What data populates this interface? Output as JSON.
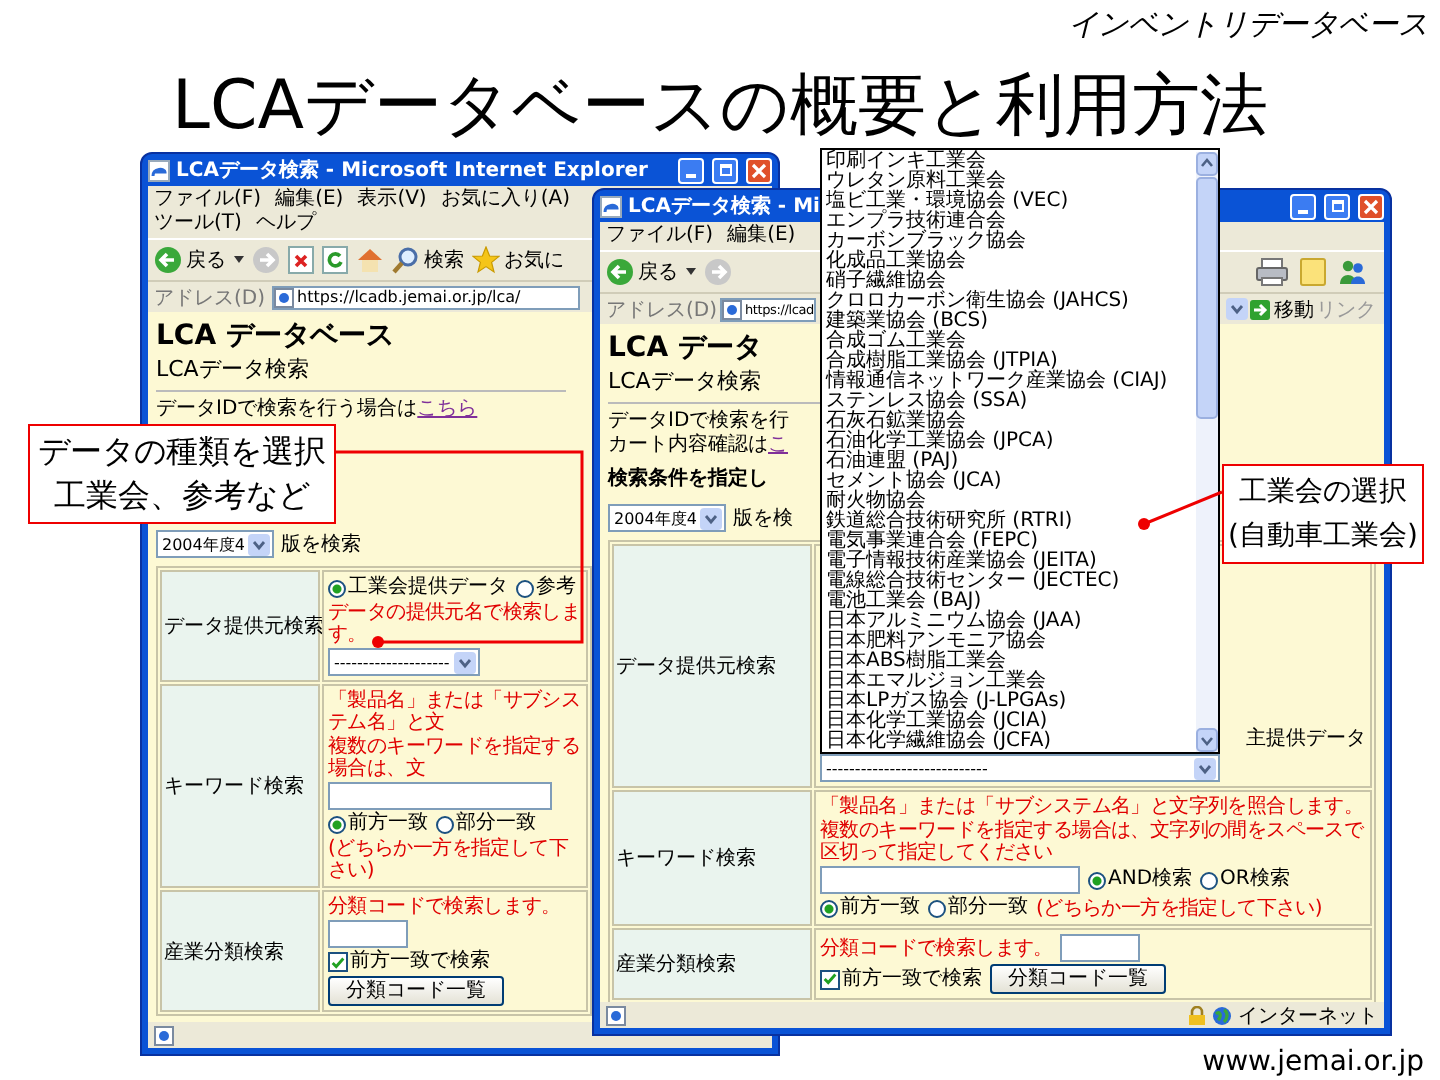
{
  "slide": {
    "subtitle": "インベントリデータベース",
    "title": "LCAデータベースの概要と利用方法",
    "footer": "www.jemai.or.jp"
  },
  "windows": [
    {
      "title": "LCAデータ検索 - Microsoft Internet Explorer",
      "menu": [
        "ファイル(F)",
        "編集(E)",
        "表示(V)",
        "お気に入り(A)",
        "ツール(T)",
        "ヘルプ"
      ],
      "toolbar": {
        "back": "戻る",
        "search": "検索",
        "favorites": "お気に"
      },
      "address": {
        "label": "アドレス(D)",
        "url": "https://lcadb.jemai.or.jp/lca/"
      },
      "page": {
        "heading": "LCA データベース",
        "subheading": "LCAデータ検索",
        "lines": [
          {
            "text": "データIDで検索を行う場合は",
            "link": "こちら"
          }
        ],
        "version": {
          "value": "2004年度4",
          "label": "版を検索"
        }
      },
      "form": [
        {
          "kind": "source",
          "label": "データ提供元検索",
          "options": [
            {
              "label": "工業会提供データ",
              "selected": true
            },
            {
              "label": "参考",
              "selected": false
            }
          ],
          "note": "データの提供元名で検索します。",
          "select": "--------------------"
        },
        {
          "kind": "keyword",
          "label": "キーワード検索",
          "notes": [
            "「製品名」または「サブシステム名」と文",
            "複数のキーワードを指定する場合は、文"
          ],
          "match": [
            {
              "label": "前方一致",
              "selected": true
            },
            {
              "label": "部分一致",
              "selected": false
            }
          ],
          "hint": "(どちらか一方を指定して下さい)"
        },
        {
          "kind": "category",
          "label": "産業分類検索",
          "note": "分類コードで検索します。",
          "checkbox": {
            "label": "前方一致で検索",
            "checked": true
          },
          "button": "分類コード一覧"
        }
      ]
    },
    {
      "title": "LCAデータ検索 - Mi",
      "menu": [
        "ファイル(F)",
        "編集(E)"
      ],
      "toolbar": {
        "back": "戻る"
      },
      "address": {
        "label": "アドレス(D)",
        "url": "https://lcad",
        "go": "移動",
        "links": "リンク"
      },
      "page": {
        "heading": "LCA データ",
        "subheading": "LCAデータ検索",
        "lines": [
          {
            "text": "データIDで検索を行"
          },
          {
            "text": "カート内容確認は",
            "link": "こ"
          }
        ],
        "bold_line": "検索条件を指定し",
        "version": {
          "value": "2004年度4",
          "label": "版を検"
        }
      },
      "form": [
        {
          "kind": "source",
          "label": "データ提供元検索",
          "tail": "主提供データ",
          "select": "----------------------------",
          "list": [
            "印刷インキ工業会",
            "ウレタン原料工業会",
            "塩ビ工業・環境協会 (VEC)",
            "エンプラ技術連合会",
            "カーボンブラック協会",
            "化成品工業協会",
            "硝子繊維協会",
            "クロロカーボン衛生協会 (JAHCS)",
            "建築業協会 (BCS)",
            "合成ゴム工業会",
            "合成樹脂工業協会 (JTPIA)",
            "情報通信ネットワーク産業協会 (CIAJ)",
            "ステンレス協会 (SSA)",
            "石灰石鉱業協会",
            "石油化学工業協会 (JPCA)",
            "石油連盟 (PAJ)",
            "セメント協会 (JCA)",
            "耐火物協会",
            "鉄道総合技術研究所 (RTRI)",
            "電気事業連合会 (FEPC)",
            "電子情報技術産業協会 (JEITA)",
            "電線総合技術センター (JECTEC)",
            "電池工業会 (BAJ)",
            "日本アルミニウム協会 (JAA)",
            "日本肥料アンモニア協会",
            "日本ABS樹脂工業会",
            "日本エマルジョン工業会",
            "日本LPガス協会 (J-LPGAs)",
            "日本化学工業協会 (JCIA)",
            "日本化学繊維協会 (JCFA)"
          ]
        },
        {
          "kind": "keyword",
          "label": "キーワード検索",
          "notes": [
            "「製品名」または「サブシステム名」と文字列を照合します。",
            "複数のキーワードを指定する場合は、文字列の間をスペースで区切って指定してください"
          ],
          "logic": [
            {
              "label": "AND検索",
              "selected": true
            },
            {
              "label": "OR検索",
              "selected": false
            }
          ],
          "match": [
            {
              "label": "前方一致",
              "selected": true
            },
            {
              "label": "部分一致",
              "selected": false
            }
          ],
          "hint": "(どちらか一方を指定して下さい)"
        },
        {
          "kind": "category",
          "label": "産業分類検索",
          "note": "分類コードで検索します。",
          "checkbox": {
            "label": "前方一致で検索",
            "checked": true
          },
          "button": "分類コード一覧"
        }
      ],
      "status": "インターネット"
    }
  ],
  "callouts": [
    {
      "lines": [
        "データの種類を選択",
        "工業会、参考など"
      ]
    },
    {
      "lines": [
        "工業会の選択",
        "(自動車工業会)"
      ]
    }
  ]
}
